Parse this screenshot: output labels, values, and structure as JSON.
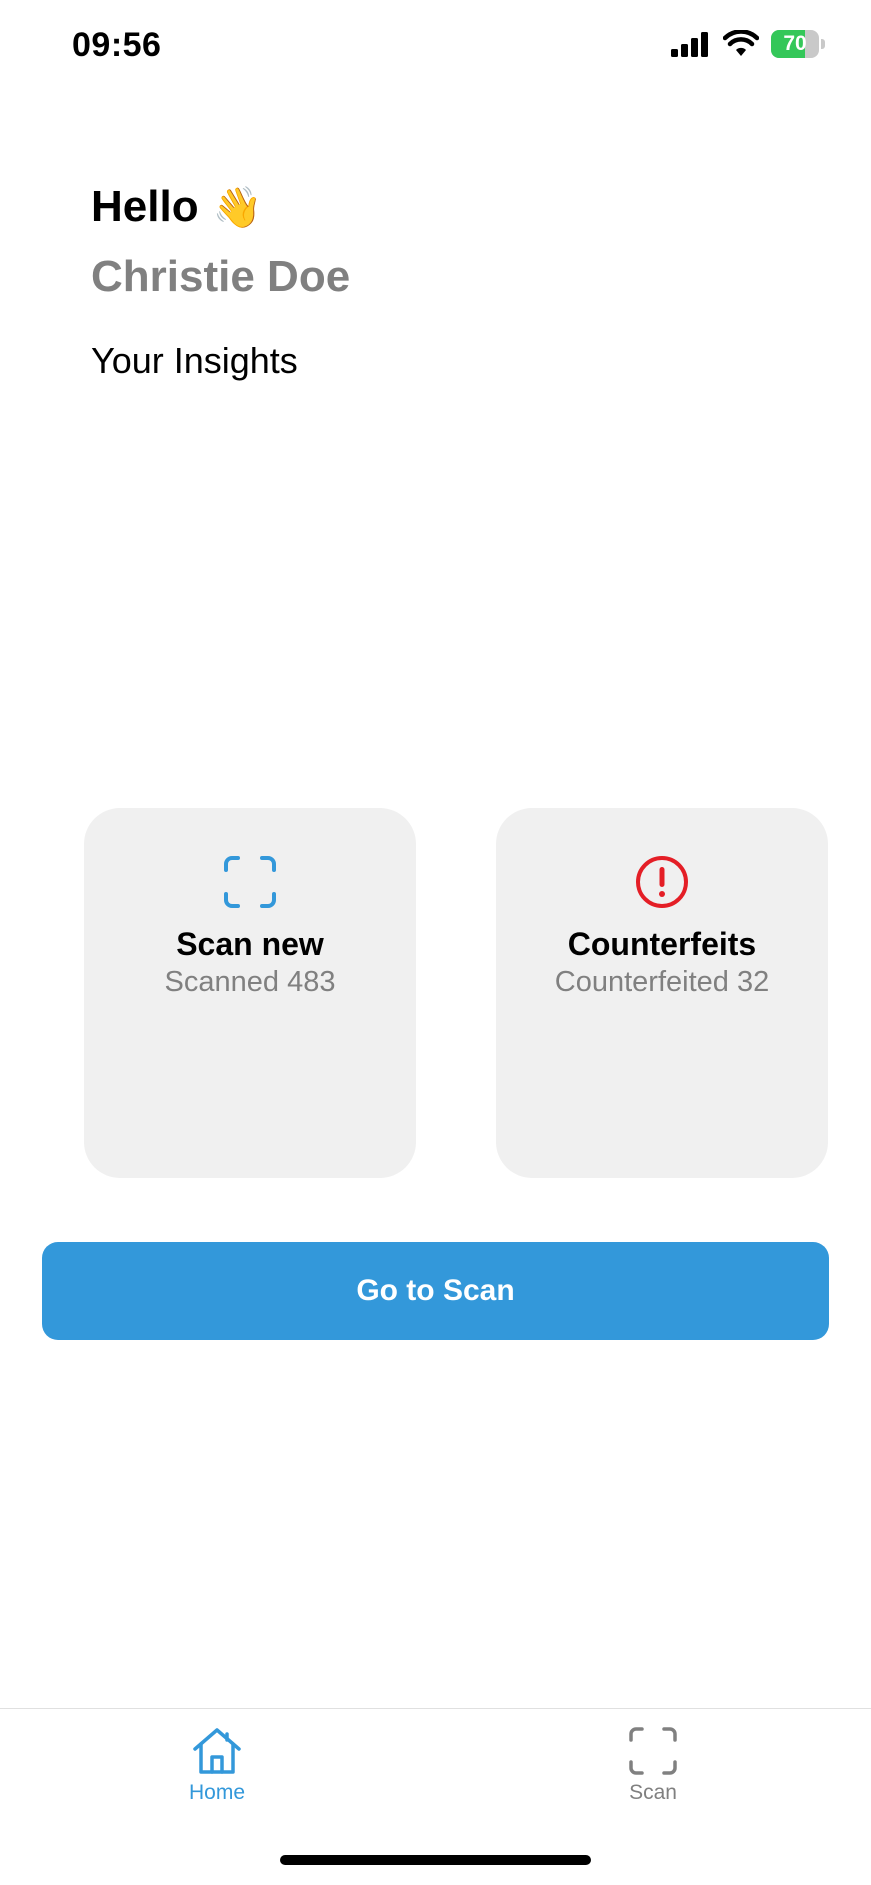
{
  "status_bar": {
    "time": "09:56",
    "battery_level": "70",
    "battery_fraction": 0.7,
    "icons": [
      "cellular-signal-icon",
      "wifi-icon",
      "battery-charging-icon"
    ]
  },
  "greeting": {
    "hello": "Hello",
    "wave_emoji": "👋",
    "user_name": "Christie Doe",
    "section_title": "Your Insights"
  },
  "cards": {
    "scan": {
      "icon": "scan-frame-icon",
      "title": "Scan new",
      "subtitle": "Scanned 483"
    },
    "counterfeits": {
      "icon": "exclamation-circle-icon",
      "title": "Counterfeits",
      "subtitle": "Counterfeited 32"
    }
  },
  "primary_button": {
    "label": "Go to Scan"
  },
  "tab_bar": {
    "tabs": [
      {
        "label": "Home",
        "icon": "home-icon",
        "active": true
      },
      {
        "label": "Scan",
        "icon": "scan-frame-icon",
        "active": false
      }
    ]
  },
  "colors": {
    "accent": "#3398da",
    "danger": "#e41e26",
    "card_bg": "#f0f0f0",
    "muted_text": "#808080",
    "battery_green": "#34c759"
  }
}
